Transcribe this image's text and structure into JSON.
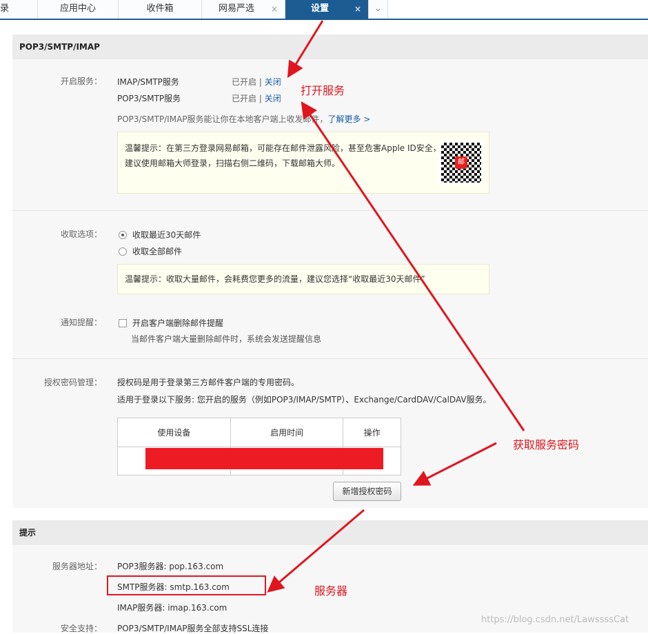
{
  "tabs": [
    {
      "label": "录",
      "closable": false
    },
    {
      "label": "应用中心",
      "closable": false
    },
    {
      "label": "收件箱",
      "closable": false
    },
    {
      "label": "网易严选",
      "closable": true
    },
    {
      "label": "设置",
      "closable": true,
      "active": true
    }
  ],
  "tab_close_glyph": "×",
  "tab_more_glyph": "⌄",
  "pop_section": {
    "title": "POP3/SMTP/IMAP",
    "services_label": "开启服务：",
    "services": [
      {
        "name": "IMAP/SMTP服务",
        "status": "已开启",
        "sep": "|",
        "action": "关闭"
      },
      {
        "name": "POP3/SMTP服务",
        "status": "已开启",
        "sep": "|",
        "action": "关闭"
      }
    ],
    "desc": "POP3/SMTP/IMAP服务能让你在本地客户端上收发邮件，",
    "learn_more": "了解更多 >",
    "tip1": "温馨提示：在第三方登录网易邮箱，可能存在邮件泄露风险，甚至危害Apple ID安全，建议使用邮箱大师登录，扫描右侧二维码，下载邮箱大师。",
    "qr_badge": "邮",
    "fetch_label": "收取选项：",
    "fetch_options": [
      {
        "label": "收取最近30天邮件",
        "checked": true
      },
      {
        "label": "收取全部邮件",
        "checked": false
      }
    ],
    "tip2": "温馨提示：收取大量邮件，会耗费您更多的流量，建议您选择“收取最近30天邮件”",
    "notify_label": "通知提醒：",
    "notify_option": "开启客户端删除邮件提醒",
    "notify_desc": "当邮件客户端大量删除邮件时，系统会发送提醒信息",
    "auth_label": "授权密码管理：",
    "auth_desc1": "授权码是用于登录第三方邮件客户端的专用密码。",
    "auth_desc2": "适用于登录以下服务: 您开启的服务（例如POP3/IMAP/SMTP）、Exchange/CardDAV/CalDAV服务。",
    "auth_table_headers": [
      "使用设备",
      "启用时间",
      "操作"
    ],
    "add_auth_button": "新增授权密码"
  },
  "tips_section": {
    "title": "提示",
    "server_label": "服务器地址：",
    "servers": [
      "POP3服务器: pop.163.com",
      "SMTP服务器: smtp.163.com",
      "IMAP服务器: imap.163.com"
    ],
    "security_label": "安全支持：",
    "security": "POP3/SMTP/IMAP服务全部支持SSL连接"
  },
  "annotations": {
    "open_service": "打开服务",
    "get_password": "获取服务密码",
    "server": "服务器"
  },
  "watermark": "https://blog.csdn.net/LawssssCat",
  "colors": {
    "tab_active": "#1c5c93",
    "annotation": "#e0161e",
    "link": "#1a5da6"
  }
}
